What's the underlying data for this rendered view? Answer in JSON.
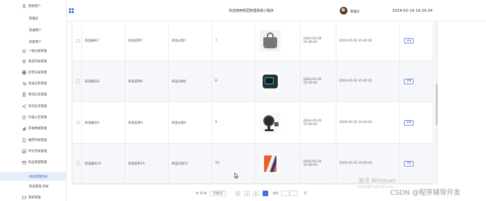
{
  "sidebar": {
    "items": [
      {
        "label": "系统用户",
        "icon": "user-icon",
        "sub": false,
        "active": false
      },
      {
        "label": "管理员",
        "icon": "",
        "sub": true,
        "active": false
      },
      {
        "label": "普通用户",
        "icon": "",
        "sub": true,
        "active": false
      },
      {
        "label": "商家用户",
        "icon": "",
        "sub": true,
        "active": false
      },
      {
        "label": "一级分类管理",
        "icon": "list-icon",
        "sub": false,
        "active": false
      },
      {
        "label": "类型列表管理",
        "icon": "settings-icon",
        "sub": false,
        "active": false
      },
      {
        "label": "反馈记录管理",
        "icon": "grid-icon",
        "sub": false,
        "active": false
      },
      {
        "label": "商品信息管理",
        "icon": "cart-icon",
        "sub": false,
        "active": false
      },
      {
        "label": "物流信息管理",
        "icon": "document-icon",
        "sub": false,
        "active": false
      },
      {
        "label": "资讯信息管理",
        "icon": "share-icon",
        "sub": false,
        "active": false
      },
      {
        "label": "外链公告管理",
        "icon": "clock-icon",
        "sub": false,
        "active": false
      },
      {
        "label": "开发数据管理",
        "icon": "chart-icon",
        "sub": false,
        "active": false
      },
      {
        "label": "推荐列表管理",
        "icon": "file-icon",
        "sub": false,
        "active": false
      },
      {
        "label": "评论列表管理",
        "icon": "image-icon",
        "sub": false,
        "active": false
      },
      {
        "label": "商品管理管理",
        "icon": "box-icon",
        "sub": false,
        "active": false
      },
      {
        "label": "商品管理列表",
        "icon": "",
        "sub": true,
        "active": true
      },
      {
        "label": "商品管理 添加",
        "icon": "",
        "sub": true,
        "active": false
      },
      {
        "label": "系统管理",
        "icon": "gear-icon",
        "sub": false,
        "active": false
      }
    ]
  },
  "header": {
    "title": "欢迎使用校园管理系统小程序",
    "user": "管理员",
    "datetime": "2024-05-16 16:20:34"
  },
  "table": {
    "detail_label": "详情",
    "rows": [
      {
        "code": "商品编号7",
        "name": "商品名称7",
        "category": "商品分类7",
        "stock": "7",
        "image": "bag",
        "created": "2024-05-16 15:40:42",
        "updated": "2024-05-16 15:40:42"
      },
      {
        "code": "商品编号8",
        "name": "商品名称8",
        "category": "商品分类8",
        "stock": "8",
        "image": "monitor",
        "created": "2024-05-16 15:40:42",
        "updated": "2024-05-16 15:40:42"
      },
      {
        "code": "商品编号9",
        "name": "商品名称9",
        "category": "商品分类9",
        "stock": "9",
        "image": "fan",
        "created": "2024-05-16 15:40:42",
        "updated": "2024-05-16 15:40:42"
      },
      {
        "code": "商品编号10",
        "name": "商品名称10",
        "category": "商品分类10",
        "stock": "10",
        "image": "phone",
        "created": "2024-05-16 15:40:42",
        "updated": "2024-05-16 15:40:42"
      }
    ]
  },
  "pagination": {
    "total": "共 10 条",
    "page_size": "10条/页",
    "prev": "‹",
    "pages": [
      "1",
      "2"
    ],
    "current": "1",
    "next": "›",
    "goto_label": "前往",
    "goto_value": "1",
    "page_suffix": "页"
  },
  "overlays": {
    "windows_line1": "激活 Windows",
    "windows_line2": "转到\"设置\"以激活 Windows。",
    "csdn": "CSDN @程序辅导开发"
  },
  "colors": {
    "accent": "#3d6fd8",
    "active_bg": "#e8eef9",
    "row_alt": "#f5f7fa"
  }
}
